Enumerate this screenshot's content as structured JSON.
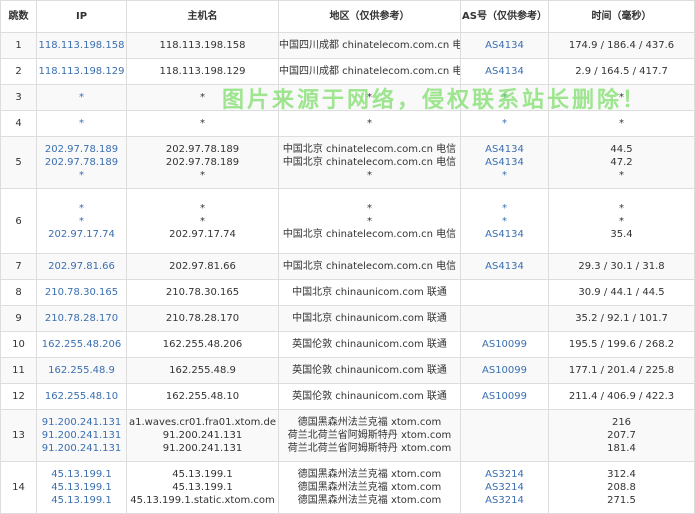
{
  "header": {
    "hop": "跳数",
    "ip": "IP",
    "host": "主机名",
    "region": "地区（仅供参考）",
    "as": "AS号（仅供参考）",
    "time": "时间（毫秒）"
  },
  "rows": [
    {
      "hop": "1",
      "ip": [
        "118.113.198.158"
      ],
      "host": [
        "118.113.198.158"
      ],
      "region": [
        "中国四川成都 chinatelecom.com.cn 电信"
      ],
      "as": [
        "AS4134"
      ],
      "time": [
        "174.9 / 186.4 / 437.6"
      ]
    },
    {
      "hop": "2",
      "ip": [
        "118.113.198.129"
      ],
      "host": [
        "118.113.198.129"
      ],
      "region": [
        "中国四川成都 chinatelecom.com.cn 电信"
      ],
      "as": [
        "AS4134"
      ],
      "time": [
        "2.9 / 164.5 / 417.7"
      ]
    },
    {
      "hop": "3",
      "ip": [
        "*"
      ],
      "host": [
        "*"
      ],
      "region": [
        "*"
      ],
      "as": [
        "*"
      ],
      "time": [
        "*"
      ]
    },
    {
      "hop": "4",
      "ip": [
        "*"
      ],
      "host": [
        "*"
      ],
      "region": [
        "*"
      ],
      "as": [
        "*"
      ],
      "time": [
        "*"
      ]
    },
    {
      "hop": "5",
      "ip": [
        "202.97.78.189",
        "202.97.78.189",
        "*"
      ],
      "host": [
        "202.97.78.189",
        "202.97.78.189",
        "*"
      ],
      "region": [
        "中国北京 chinatelecom.com.cn 电信",
        "中国北京 chinatelecom.com.cn 电信",
        "*"
      ],
      "as": [
        "AS4134",
        "AS4134",
        "*"
      ],
      "time": [
        "44.5",
        "47.2",
        "*"
      ]
    },
    {
      "hop": "6",
      "ip": [
        "*",
        "*",
        "202.97.17.74"
      ],
      "host": [
        "*",
        "*",
        "202.97.17.74"
      ],
      "region": [
        "*",
        "*",
        "中国北京 chinatelecom.com.cn 电信"
      ],
      "as": [
        "*",
        "*",
        "AS4134"
      ],
      "time": [
        "*",
        "*",
        "35.4"
      ]
    },
    {
      "hop": "7",
      "ip": [
        "202.97.81.66"
      ],
      "host": [
        "202.97.81.66"
      ],
      "region": [
        "中国北京 chinatelecom.com.cn 电信"
      ],
      "as": [
        "AS4134"
      ],
      "time": [
        "29.3 / 30.1 / 31.8"
      ]
    },
    {
      "hop": "8",
      "ip": [
        "210.78.30.165"
      ],
      "host": [
        "210.78.30.165"
      ],
      "region": [
        "中国北京 chinaunicom.com 联通"
      ],
      "as": [
        ""
      ],
      "time": [
        "30.9 / 44.1 / 44.5"
      ]
    },
    {
      "hop": "9",
      "ip": [
        "210.78.28.170"
      ],
      "host": [
        "210.78.28.170"
      ],
      "region": [
        "中国北京 chinaunicom.com 联通"
      ],
      "as": [
        ""
      ],
      "time": [
        "35.2 / 92.1 / 101.7"
      ]
    },
    {
      "hop": "10",
      "ip": [
        "162.255.48.206"
      ],
      "host": [
        "162.255.48.206"
      ],
      "region": [
        "英国伦敦 chinaunicom.com 联通"
      ],
      "as": [
        "AS10099"
      ],
      "time": [
        "195.5 / 199.6 / 268.2"
      ]
    },
    {
      "hop": "11",
      "ip": [
        "162.255.48.9"
      ],
      "host": [
        "162.255.48.9"
      ],
      "region": [
        "英国伦敦 chinaunicom.com 联通"
      ],
      "as": [
        "AS10099"
      ],
      "time": [
        "177.1 / 201.4 / 225.8"
      ]
    },
    {
      "hop": "12",
      "ip": [
        "162.255.48.10"
      ],
      "host": [
        "162.255.48.10"
      ],
      "region": [
        "英国伦敦 chinaunicom.com 联通"
      ],
      "as": [
        "AS10099"
      ],
      "time": [
        "211.4 / 406.9 / 422.3"
      ]
    },
    {
      "hop": "13",
      "ip": [
        "91.200.241.131",
        "91.200.241.131",
        "91.200.241.131"
      ],
      "host": [
        "a1.waves.cr01.fra01.xtom.de",
        "91.200.241.131",
        "91.200.241.131"
      ],
      "region": [
        "德国黑森州法兰克福 xtom.com",
        "荷兰北荷兰省阿姆斯特丹 xtom.com",
        "荷兰北荷兰省阿姆斯特丹 xtom.com"
      ],
      "as": [
        "",
        "",
        ""
      ],
      "time": [
        "216",
        "207.7",
        "181.4"
      ]
    },
    {
      "hop": "14",
      "ip": [
        "45.13.199.1",
        "45.13.199.1",
        "45.13.199.1"
      ],
      "host": [
        "45.13.199.1",
        "45.13.199.1",
        "45.13.199.1.static.xtom.com"
      ],
      "region": [
        "德国黑森州法兰克福 xtom.com",
        "德国黑森州法兰克福 xtom.com",
        "德国黑森州法兰克福 xtom.com"
      ],
      "as": [
        "AS3214",
        "AS3214",
        "AS3214"
      ],
      "time": [
        "312.4",
        "208.8",
        "271.5"
      ]
    }
  ],
  "watermark": "图片来源于网络，侵权联系站长删除！"
}
